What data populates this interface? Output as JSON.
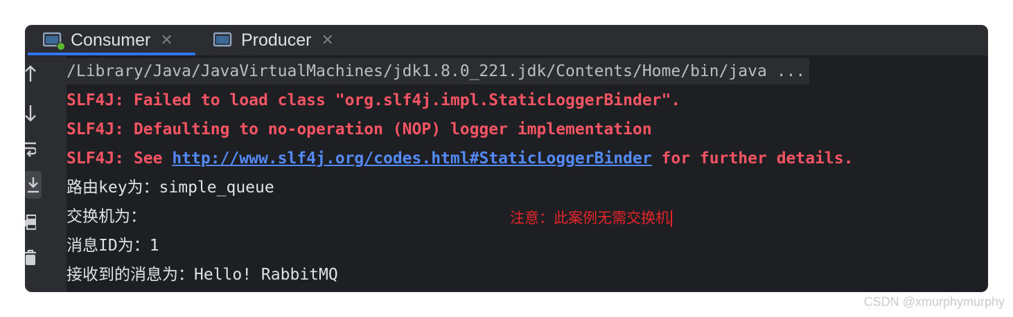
{
  "tabs": [
    {
      "label": "Consumer",
      "active": true,
      "running": true
    },
    {
      "label": "Producer",
      "active": false,
      "running": false
    }
  ],
  "toolbar": {
    "icons": [
      "arrow-up-icon",
      "arrow-down-icon",
      "soft-wrap-icon",
      "scroll-to-end-icon",
      "print-icon",
      "trash-icon"
    ]
  },
  "console": {
    "command": "/Library/Java/JavaVirtualMachines/jdk1.8.0_221.jdk/Contents/Home/bin/java ...",
    "errors": [
      "SLF4J: Failed to load class \"org.slf4j.impl.StaticLoggerBinder\".",
      "SLF4J: Defaulting to no-operation (NOP) logger implementation"
    ],
    "see_prefix": "SLF4J: See ",
    "see_link": "http://www.slf4j.org/codes.html#StaticLoggerBinder",
    "see_suffix": " for further details.",
    "output": [
      "路由key为：simple_queue",
      "交换机为：",
      "消息ID为：1",
      "接收到的消息为：Hello! RabbitMQ"
    ]
  },
  "annotation": "注意：此案例无需交换机",
  "watermark": "CSDN @xmurphymurphy",
  "colors": {
    "error": "#f75464",
    "link": "#548af7",
    "annotation": "#e8242b",
    "accent": "#3574f0",
    "background": "#1e1f22"
  }
}
